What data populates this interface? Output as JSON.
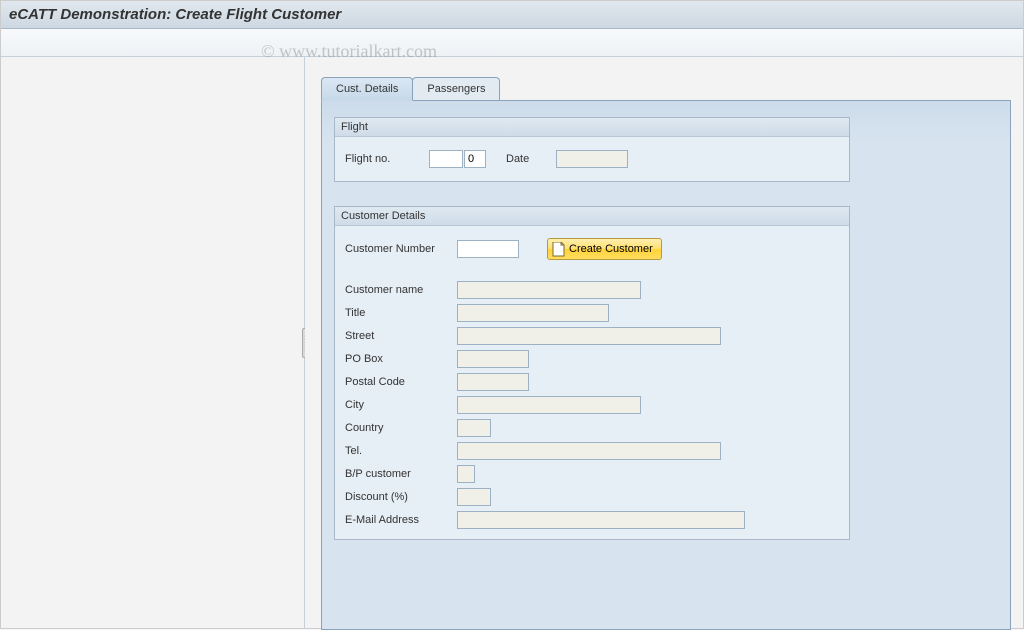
{
  "title": "eCATT Demonstration: Create Flight Customer",
  "watermark": "© www.tutorialkart.com",
  "tabs": {
    "active": "Cust. Details",
    "inactive": "Passengers"
  },
  "flight": {
    "group_title": "Flight",
    "fields": {
      "flight_no_label": "Flight no.",
      "flight_no_1": "",
      "flight_no_2": "0",
      "date_label": "Date",
      "date_value": ""
    }
  },
  "customer": {
    "group_title": "Customer Details",
    "fields": {
      "customer_number_label": "Customer Number",
      "customer_number_value": "",
      "create_customer_btn": "Create Customer",
      "customer_name_label": "Customer name",
      "customer_name_value": "",
      "title_label": "Title",
      "title_value": "",
      "street_label": "Street",
      "street_value": "",
      "pobox_label": "PO Box",
      "pobox_value": "",
      "postal_code_label": "Postal Code",
      "postal_code_value": "",
      "city_label": "City",
      "city_value": "",
      "country_label": "Country",
      "country_value": "",
      "tel_label": "Tel.",
      "tel_value": "",
      "bp_customer_label": "B/P customer",
      "bp_customer_value": "",
      "discount_label": "Discount (%)",
      "discount_value": "",
      "email_label": "E-Mail Address",
      "email_value": ""
    }
  }
}
